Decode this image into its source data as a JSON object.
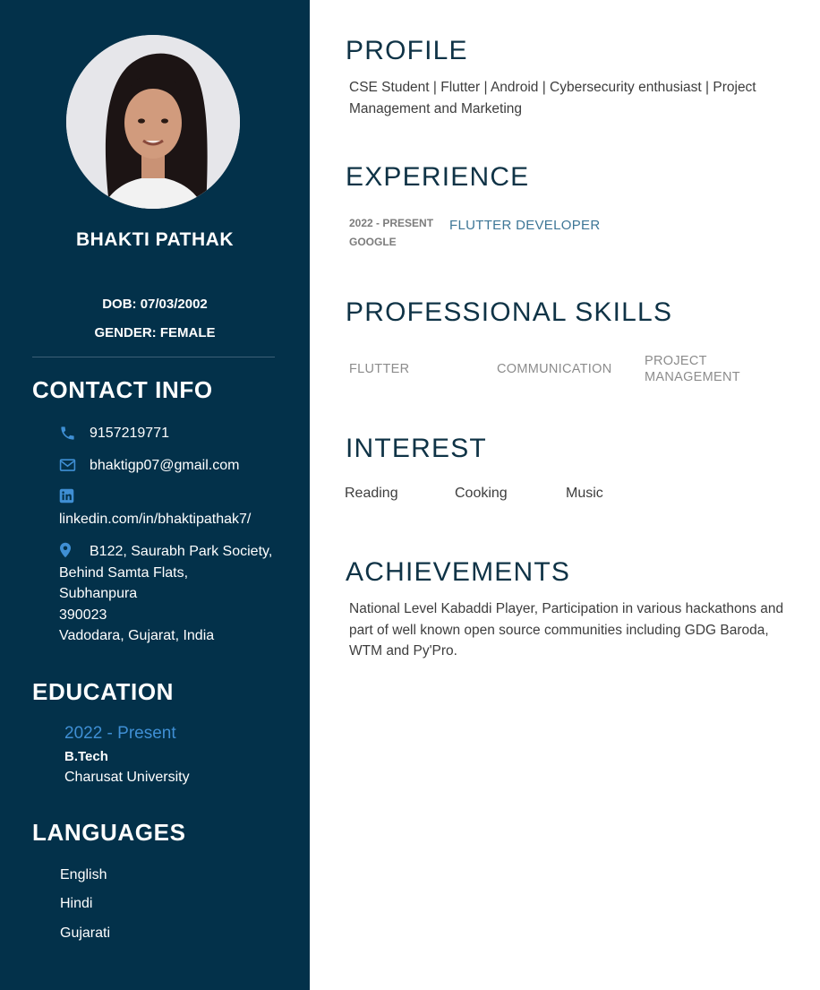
{
  "profile_card": {
    "name": "BHAKTI PATHAK",
    "dob": "DOB: 07/03/2002",
    "gender": "GENDER: FEMALE"
  },
  "contact": {
    "heading": "CONTACT INFO",
    "phone": "9157219771",
    "email": "bhaktigp07@gmail.com",
    "linkedin": "linkedin.com/in/bhaktipathak7/",
    "address_lines": [
      "B122, Saurabh Park Society,",
      "Behind Samta Flats,",
      "Subhanpura",
      "390023",
      "Vadodara, Gujarat, India"
    ],
    "icons": [
      "phone-icon",
      "email-icon",
      "linkedin-icon",
      "location-icon"
    ]
  },
  "education": {
    "heading": "EDUCATION",
    "years": "2022 - Present",
    "degree": "B.Tech",
    "school": "Charusat University"
  },
  "languages": {
    "heading": "LANGUAGES",
    "items": [
      "English",
      "Hindi",
      "Gujarati"
    ]
  },
  "profile": {
    "heading": "PROFILE",
    "text": "CSE Student | Flutter | Android | Cybersecurity enthusiast | Project Management and Marketing"
  },
  "experience": {
    "heading": "EXPERIENCE",
    "years": "2022 - PRESENT",
    "company": "GOOGLE",
    "role": "FLUTTER DEVELOPER"
  },
  "skills": {
    "heading": "PROFESSIONAL SKILLS",
    "items": [
      "FLUTTER",
      "COMMUNICATION",
      "PROJECT MANAGEMENT"
    ]
  },
  "interest": {
    "heading": "INTEREST",
    "items": [
      "Reading",
      "Cooking",
      "Music"
    ]
  },
  "achievements": {
    "heading": "ACHIEVEMENTS",
    "text": "National Level Kabaddi Player, Participation in various hackathons and part of well known open source communities including GDG Baroda, WTM and Py'Pro."
  },
  "colors": {
    "sidebar_bg": "#03314a",
    "accent_blue": "#3f8fd4",
    "heading_dark": "#0f3346",
    "role_blue": "#3d7696"
  }
}
